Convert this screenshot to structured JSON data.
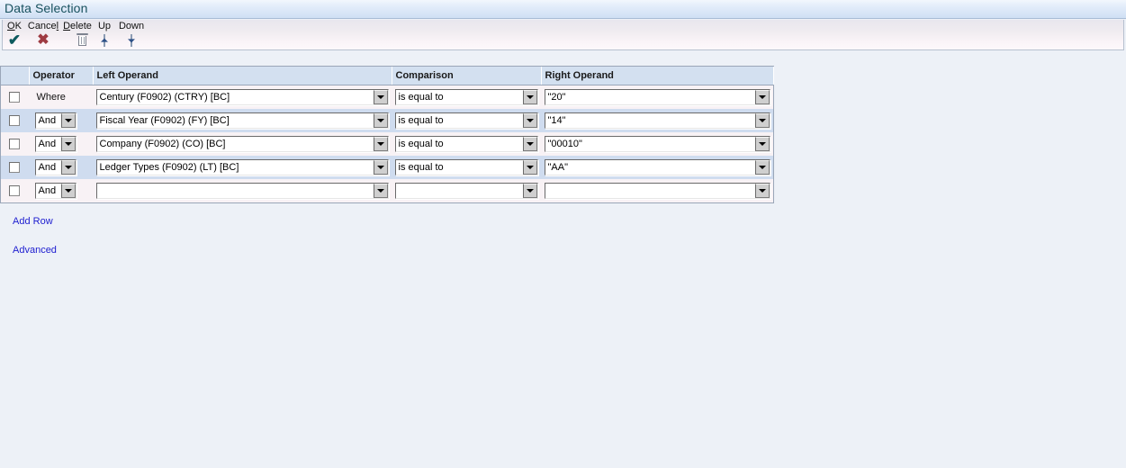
{
  "window": {
    "title": "Data Selection"
  },
  "toolbar": {
    "items": [
      {
        "label": "OK",
        "accesskey": "O",
        "icon": "check-icon"
      },
      {
        "label": "Cancel",
        "accesskey": "l",
        "icon": "x-icon"
      },
      {
        "label": "Delete",
        "accesskey": "D",
        "icon": "trash-icon"
      },
      {
        "label": "Up",
        "accesskey": "",
        "icon": "chevron-up-icon"
      },
      {
        "label": "Down",
        "accesskey": "",
        "icon": "chevron-down-icon"
      }
    ],
    "ok_label": "OK",
    "cancel_label": "Cancel",
    "delete_label": "Delete",
    "up_label": "Up",
    "down_label": "Down"
  },
  "grid": {
    "headers": {
      "checkbox": "",
      "operator": "Operator",
      "left_operand": "Left Operand",
      "comparison": "Comparison",
      "right_operand": "Right Operand"
    },
    "rows": [
      {
        "selected": false,
        "operator": "Where",
        "operator_is_combo": false,
        "left_operand": "Century (F0902) (CTRY) [BC]",
        "comparison": "is equal to",
        "right_operand": "\"20\""
      },
      {
        "selected": false,
        "operator": "And",
        "operator_is_combo": true,
        "left_operand": "Fiscal Year (F0902) (FY) [BC]",
        "comparison": "is equal to",
        "right_operand": "\"14\""
      },
      {
        "selected": false,
        "operator": "And",
        "operator_is_combo": true,
        "left_operand": "Company (F0902) (CO) [BC]",
        "comparison": "is equal to",
        "right_operand": "\"00010\""
      },
      {
        "selected": false,
        "operator": "And",
        "operator_is_combo": true,
        "left_operand": "Ledger Types (F0902) (LT) [BC]",
        "comparison": "is equal to",
        "right_operand": "\"AA\""
      },
      {
        "selected": false,
        "operator": "And",
        "operator_is_combo": true,
        "left_operand": "",
        "comparison": "",
        "right_operand": ""
      }
    ]
  },
  "links": {
    "add_row": "Add Row",
    "advanced": "Advanced"
  },
  "colors": {
    "title_text": "#18515e",
    "page_background": "#edf1f7",
    "header_background": "#d3e0f0",
    "row_odd_background": "#f8f2f5",
    "row_even_background": "#cfdcef",
    "link": "#2020d0",
    "ok_icon": "#0d5a5e",
    "cancel_icon": "#9e3b42"
  }
}
